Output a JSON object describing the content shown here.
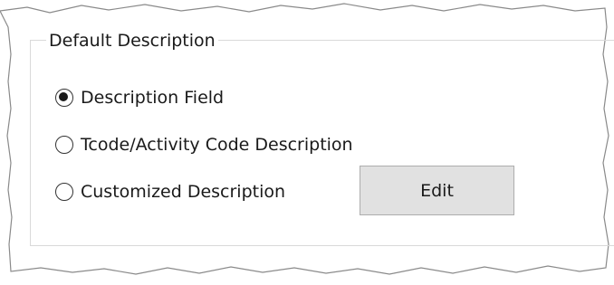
{
  "group": {
    "title": "Default Description"
  },
  "options": [
    {
      "label": "Description Field",
      "checked": true
    },
    {
      "label": "Tcode/Activity Code Description",
      "checked": false
    },
    {
      "label": "Customized Description",
      "checked": false
    }
  ],
  "edit_button": {
    "label": "Edit"
  },
  "colors": {
    "frame_border": "#8a8a8a",
    "group_border": "#d9d9d9",
    "button_background": "#e1e1e1",
    "button_border": "#adadad"
  }
}
